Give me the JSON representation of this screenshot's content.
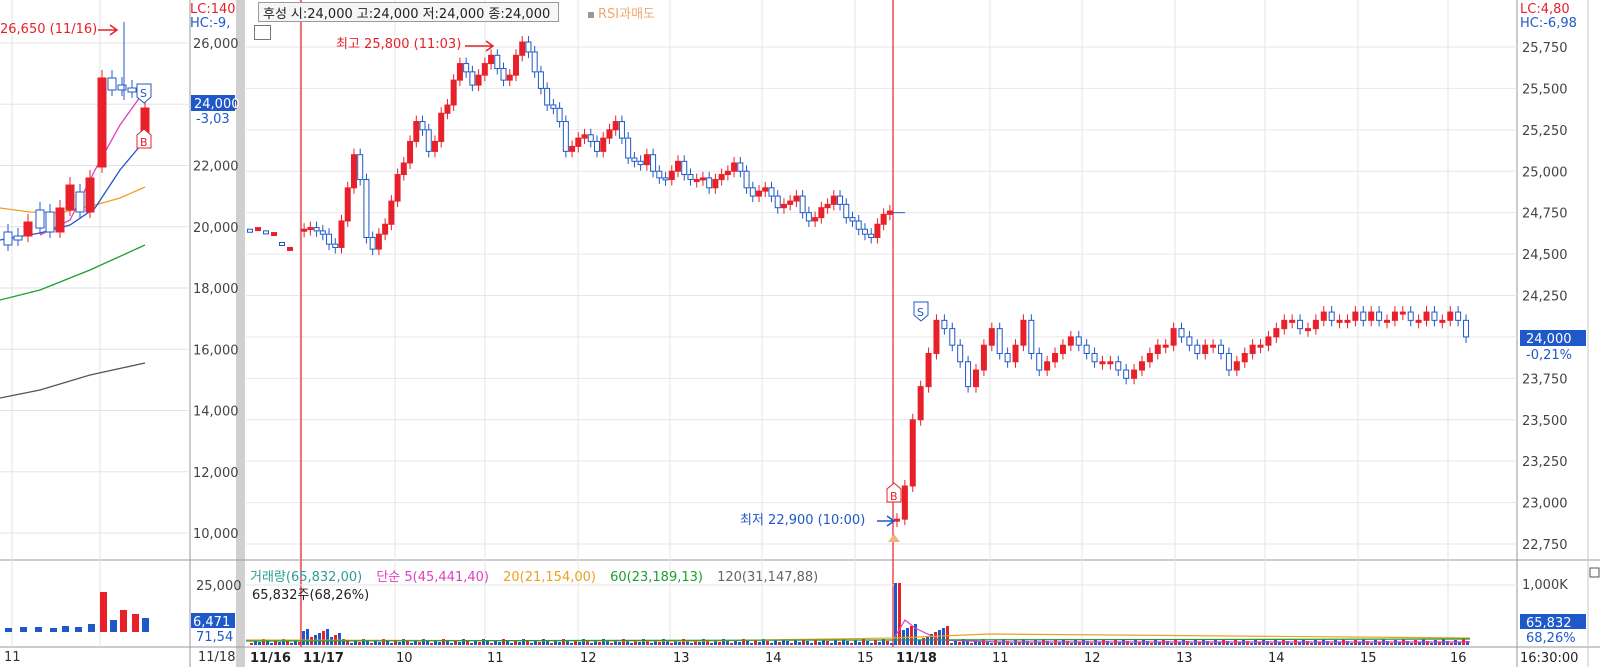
{
  "header": {
    "symbol": "후성",
    "open": "시:24,000",
    "high": "고:24,000",
    "low": "저:24,000",
    "close": "종:24,000",
    "indicator": "RSI과매도"
  },
  "left_panel": {
    "price_axis": [
      "26,000",
      "24,000",
      "22,000",
      "20,000",
      "18,000",
      "16,000",
      "14,000",
      "12,000",
      "10,000"
    ],
    "lc_label": "LC:140",
    "hc_label": "HC:-9,",
    "current_price": "24,000",
    "current_change": "-3,03",
    "high_annotation": "26,650 (11/16)",
    "volume_axis": "25,000",
    "volume_current": "6,471",
    "volume_ma": "71,54",
    "date_left": "11",
    "date_right": "11/18"
  },
  "main_chart": {
    "lc_label": "LC:4,80",
    "hc_label": "HC:-6,98",
    "high_annotation": "최고 25,800 (11:03)",
    "low_annotation": "최저 22,900 (10:00)",
    "current_price": "24,000",
    "current_change": "-0,21%",
    "signal_sell": "S",
    "signal_buy": "B"
  },
  "volume_panel": {
    "legend": {
      "volume": "거래량(65,832,00)",
      "ma5": "단순 5(45,441,40)",
      "ma20": "20(21,154,00)",
      "ma60": "60(23,189,13)",
      "ma120": "120(31,147,88)"
    },
    "subtitle": "65,832주(68,26%)",
    "axis_top": "1,000K",
    "current_volume": "65,832",
    "current_ratio": "68,26%"
  },
  "x_axis": {
    "labels": [
      "11/16",
      "11/17",
      "10",
      "11",
      "12",
      "13",
      "14",
      "15",
      "11/18",
      "11",
      "12",
      "13",
      "14",
      "15",
      "16"
    ],
    "end_time": "16:30:00"
  },
  "colors": {
    "up": "#e8202a",
    "down": "#1f58c8",
    "ma5": "#e040c0",
    "ma20": "#f0a020",
    "ma60": "#1aa030",
    "ma120": "#555555",
    "marker": "#e8202a",
    "price_label_bg": "#1f58c8"
  },
  "chart_data": {
    "type": "candlestick",
    "title": "",
    "interval": "intraday",
    "y_range": [
      22700,
      26000
    ],
    "day_separators": [
      "11/17",
      "11/18"
    ],
    "session_high": {
      "price": 25800,
      "time": "11:03"
    },
    "session_low": {
      "price": 22900,
      "time": "10:00"
    },
    "last_price": 24000,
    "last_change_pct": -0.21,
    "series": [
      {
        "name": "day1_11_17",
        "values": [
          24650,
          24660,
          24640,
          24620,
          24560,
          24540,
          24700,
          24900,
          25100,
          24950,
          24600,
          24530,
          24620,
          24680,
          24820,
          24980,
          25050,
          25180,
          25300,
          25250,
          25120,
          25180,
          25350,
          25400,
          25550,
          25650,
          25600,
          25520,
          25580,
          25650,
          25700,
          25620,
          25550,
          25580,
          25700,
          25780,
          25720,
          25600,
          25500,
          25400,
          25380,
          25300,
          25120,
          25150,
          25200,
          25220,
          25180,
          25120,
          25200,
          25250,
          25300,
          25200,
          25080,
          25060,
          25040,
          25100,
          25000,
          24960,
          24950,
          25000,
          25060,
          24980,
          24950,
          24950,
          24960,
          24900,
          24950,
          24980,
          25000,
          25050,
          25000,
          24900,
          24850,
          24880,
          24900,
          24850,
          24780,
          24800,
          24820,
          24850,
          24750,
          24700,
          24720,
          24780,
          24800,
          24850,
          24800,
          24720,
          24700,
          24650,
          24620,
          24600,
          24680,
          24740,
          24760
        ]
      },
      {
        "name": "day2_11_18",
        "values": [
          22900,
          23100,
          23500,
          23700,
          23900,
          24100,
          24050,
          23950,
          23850,
          23700,
          23800,
          23950,
          24050,
          23900,
          23850,
          23950,
          24100,
          23900,
          23800,
          23850,
          23900,
          23950,
          24000,
          23950,
          23900,
          23850,
          23850,
          23850,
          23800,
          23750,
          23800,
          23850,
          23900,
          23950,
          23950,
          24050,
          24000,
          23950,
          23900,
          23950,
          23950,
          23900,
          23800,
          23850,
          23900,
          23950,
          23950,
          24000,
          24050,
          24100,
          24100,
          24050,
          24050,
          24100,
          24150,
          24100,
          24100,
          24100,
          24150,
          24100,
          24150,
          24100,
          24100,
          24150,
          24150,
          24100,
          24100,
          24150,
          24100,
          24100,
          24150,
          24100,
          24000
        ]
      }
    ]
  }
}
